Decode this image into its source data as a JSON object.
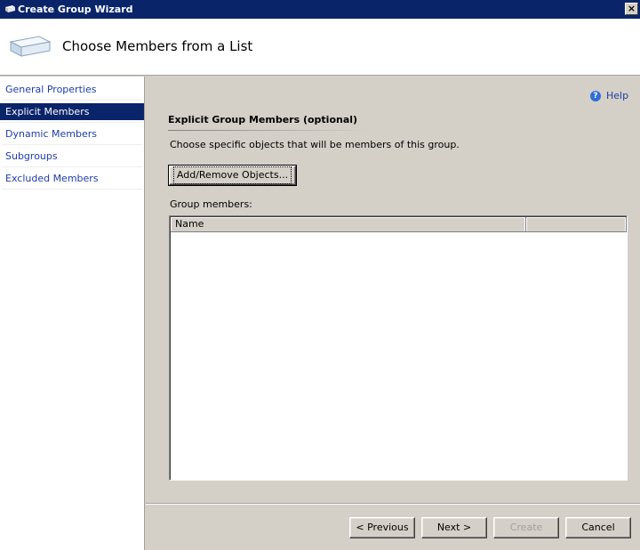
{
  "window": {
    "title": "Create Group Wizard",
    "close_label": "×"
  },
  "header": {
    "title": "Choose Members from a List"
  },
  "sidebar": {
    "items": [
      {
        "label": "General Properties",
        "selected": false
      },
      {
        "label": "Explicit Members",
        "selected": true
      },
      {
        "label": "Dynamic Members",
        "selected": false
      },
      {
        "label": "Subgroups",
        "selected": false
      },
      {
        "label": "Excluded Members",
        "selected": false
      }
    ]
  },
  "help": {
    "label": "Help",
    "icon": "question-circle-icon"
  },
  "main": {
    "section_title": "Explicit Group Members (optional)",
    "description": "Choose specific objects that will be members of this group.",
    "add_remove_label": "Add/Remove Objects...",
    "members_label": "Group members:",
    "columns": [
      "Name",
      ""
    ],
    "rows": []
  },
  "footer": {
    "previous_label": "< Previous",
    "next_label": "Next >",
    "create_label": "Create",
    "cancel_label": "Cancel"
  },
  "colors": {
    "titlebar": "#0a246a",
    "selection": "#0a246a",
    "link": "#1f3ca6",
    "dialog": "#d4d0c8"
  }
}
